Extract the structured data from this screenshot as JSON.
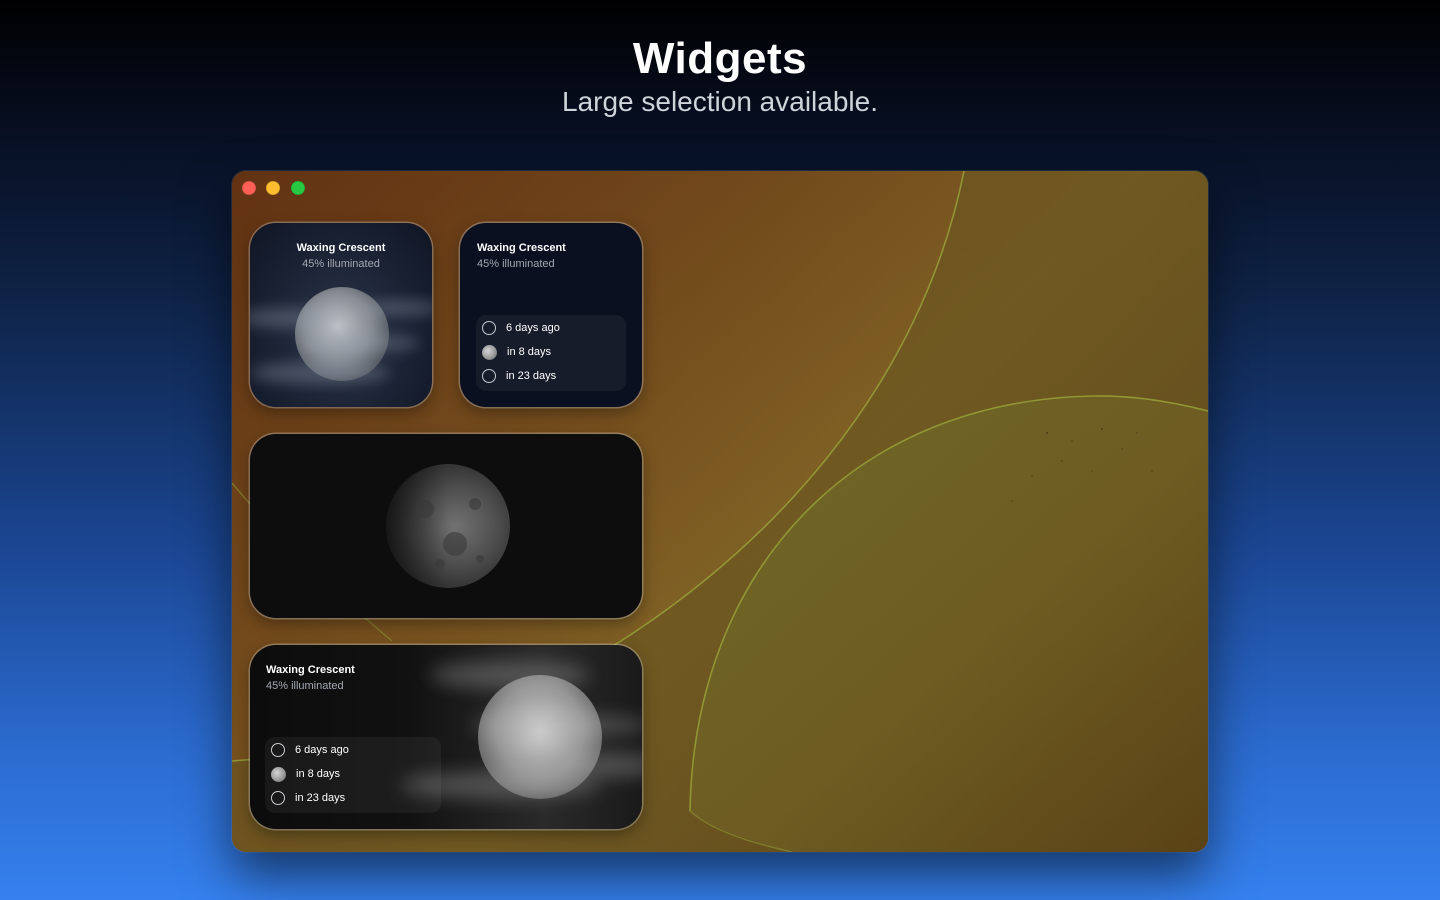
{
  "hero": {
    "title": "Widgets",
    "subtitle": "Large selection available."
  },
  "colors": {
    "close": "#fe5f57",
    "minimize": "#febc2e",
    "maximize": "#28c840",
    "accent_line": "#9aa53a"
  },
  "moon_status": {
    "phase": "Waxing Crescent",
    "illumination": "45% illuminated"
  },
  "upcoming": [
    {
      "icon": "new-moon-icon",
      "label": "6 days ago"
    },
    {
      "icon": "full-moon-icon",
      "label": "in 8 days"
    },
    {
      "icon": "new-moon-icon",
      "label": "in 23 days"
    }
  ]
}
